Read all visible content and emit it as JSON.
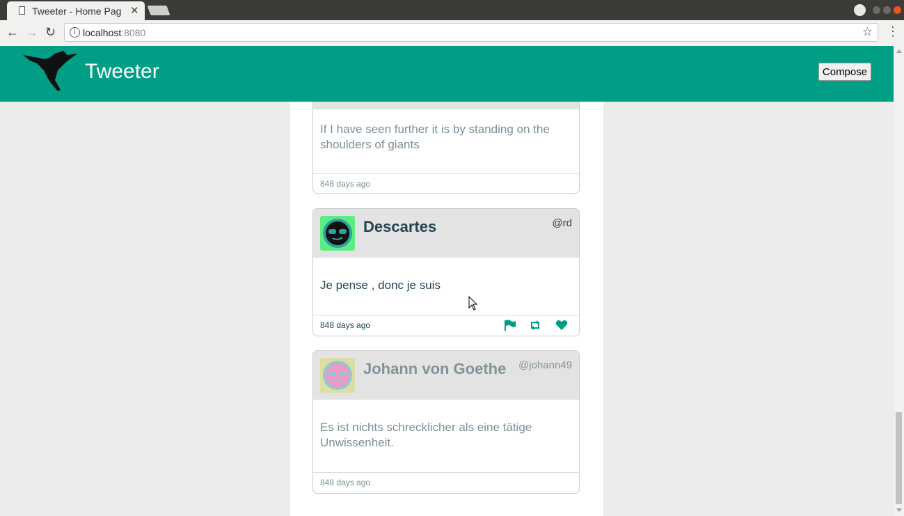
{
  "browser": {
    "tab_title": "Tweeter - Home Pag",
    "url_host": "localhost",
    "url_port": ":8080"
  },
  "header": {
    "title": "Tweeter",
    "compose_label": "Compose"
  },
  "tweets": [
    {
      "body": "If I have seen further it is by standing on the shoulders of giants",
      "time": "848 days ago"
    },
    {
      "name": "Descartes",
      "handle": "@rd",
      "body": "Je pense , donc je suis",
      "time": "848 days ago"
    },
    {
      "name": "Johann von Goethe",
      "handle": "@johann49",
      "body": "Es ist nichts schrecklicher als eine tätige Unwissenheit.",
      "time": "848 days ago"
    }
  ],
  "colors": {
    "brand": "#009e84",
    "text": "#244452",
    "card_header": "#e3e3e3"
  },
  "icons": [
    "flag-icon",
    "retweet-icon",
    "heart-icon",
    "hummingbird-logo"
  ]
}
